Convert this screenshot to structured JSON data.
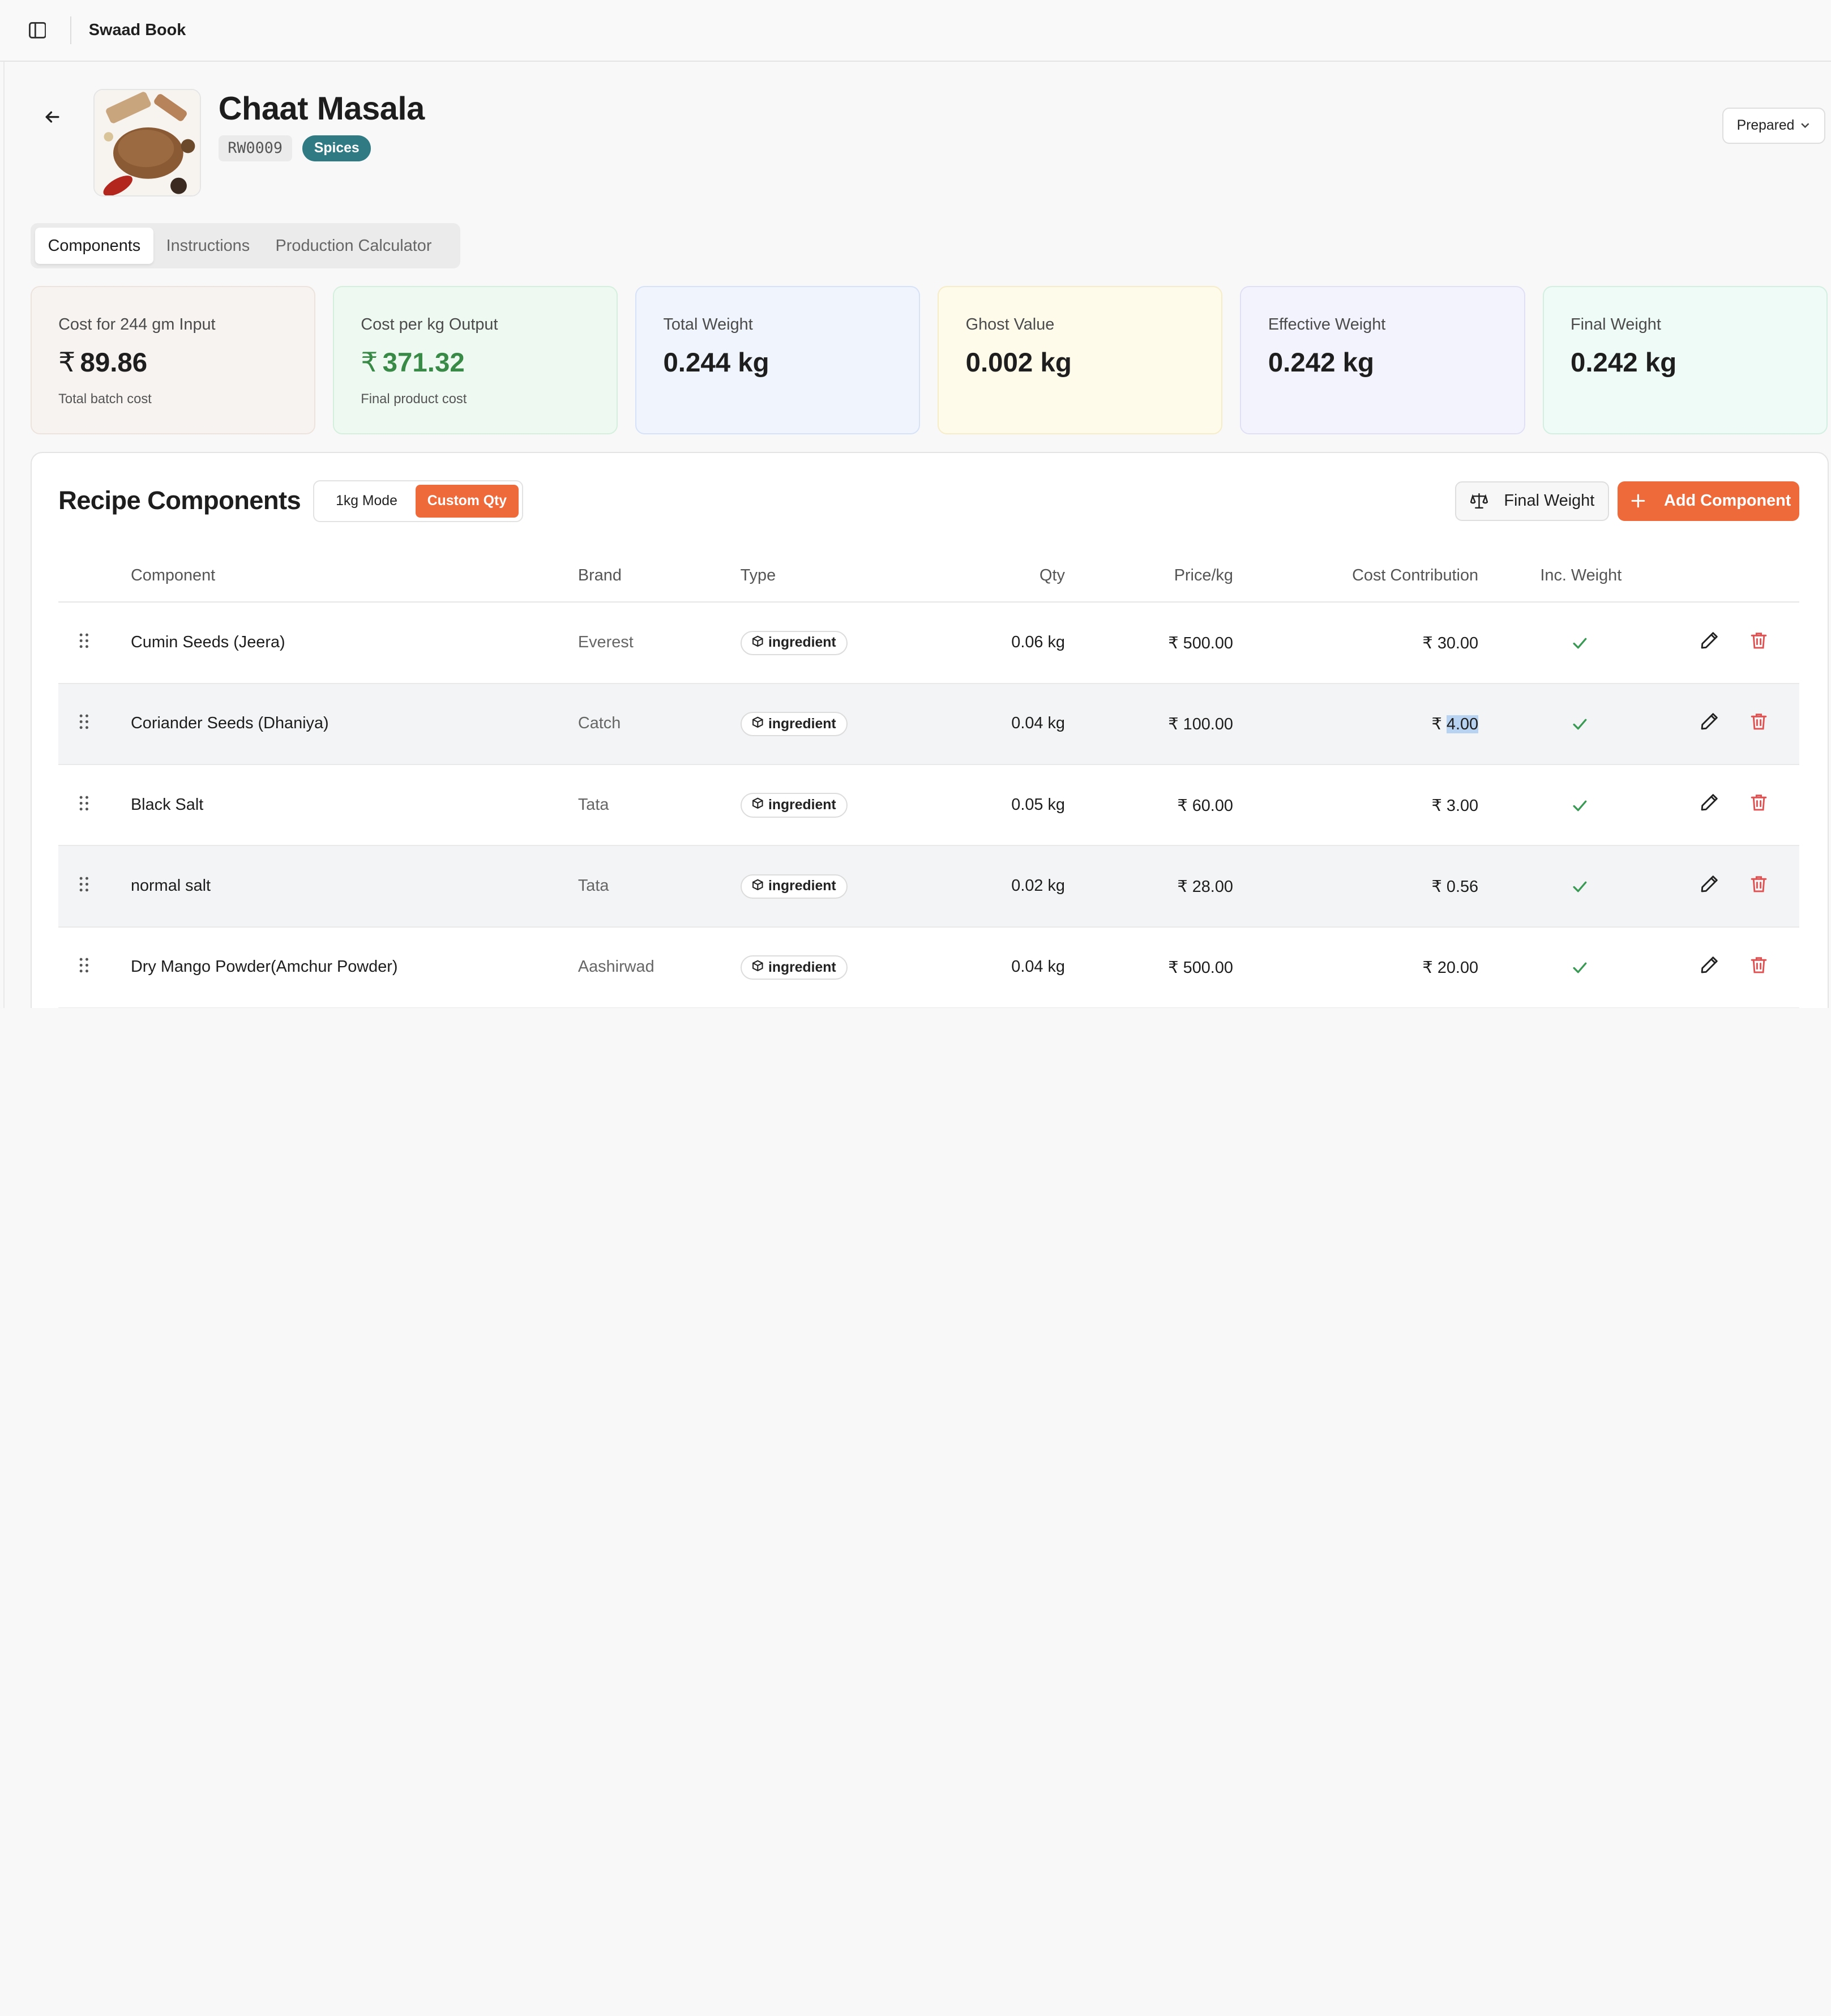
{
  "app": {
    "title": "Swaad Book"
  },
  "recipe": {
    "name": "Chaat Masala",
    "code": "RW0009",
    "category": "Spices",
    "state": "Prepared"
  },
  "tabs": [
    {
      "label": "Components",
      "active": true
    },
    {
      "label": "Instructions",
      "active": false
    },
    {
      "label": "Production Calculator",
      "active": false
    }
  ],
  "cards": [
    {
      "label": "Cost for 244 gm Input",
      "currency": "₹",
      "value": "89.86",
      "sub": "Total batch cost",
      "bg": "#f7f3f0",
      "border": "#ece3dc",
      "value_color": "#1e1e1e"
    },
    {
      "label": "Cost per kg Output",
      "currency": "₹",
      "value": "371.32",
      "sub": "Final product cost",
      "bg": "#eefaf1",
      "border": "#d5efdd",
      "value_color": "#3a8a47"
    },
    {
      "label": "Total Weight",
      "currency": "",
      "value": "0.244 kg",
      "sub": "",
      "bg": "#eff4fd",
      "border": "#d6e2f7",
      "value_color": "#1e1e1e"
    },
    {
      "label": "Ghost Value",
      "currency": "",
      "value": "0.002 kg",
      "sub": "",
      "bg": "#fffbeb",
      "border": "#f6ecc7",
      "value_color": "#1e1e1e"
    },
    {
      "label": "Effective Weight",
      "currency": "",
      "value": "0.242 kg",
      "sub": "",
      "bg": "#f3f3fd",
      "border": "#e0e0f5",
      "value_color": "#1e1e1e"
    },
    {
      "label": "Final Weight",
      "currency": "",
      "value": "0.242 kg",
      "sub": "",
      "bg": "#eefbf6",
      "border": "#d2efe2",
      "value_color": "#1e1e1e"
    }
  ],
  "components_panel": {
    "title": "Recipe Components",
    "mode_1kg": "1kg Mode",
    "mode_custom": "Custom Qty",
    "final_weight_button": "Final Weight",
    "add_button": "Add Component",
    "columns": {
      "component": "Component",
      "brand": "Brand",
      "type": "Type",
      "qty": "Qty",
      "price": "Price/kg",
      "cost": "Cost Contribution",
      "inc_weight": "Inc. Weight"
    },
    "rows": [
      {
        "name": "Cumin Seeds (Jeera)",
        "brand": "Everest",
        "type": "ingredient",
        "qty": "0.06 kg",
        "price": "₹ 500.00",
        "cost_currency": "₹",
        "cost_value": "30.00",
        "inc_weight": true
      },
      {
        "name": "Coriander Seeds (Dhaniya)",
        "brand": "Catch",
        "type": "ingredient",
        "qty": "0.04 kg",
        "price": "₹ 100.00",
        "cost_currency": "₹",
        "cost_value": "4.00",
        "inc_weight": true
      },
      {
        "name": "Black Salt",
        "brand": "Tata",
        "type": "ingredient",
        "qty": "0.05 kg",
        "price": "₹ 60.00",
        "cost_currency": "₹",
        "cost_value": "3.00",
        "inc_weight": true
      },
      {
        "name": "normal salt",
        "brand": "Tata",
        "type": "ingredient",
        "qty": "0.02 kg",
        "price": "₹ 28.00",
        "cost_currency": "₹",
        "cost_value": "0.56",
        "inc_weight": true
      },
      {
        "name": "Dry Mango Powder(Amchur Powder)",
        "brand": "Aashirwad",
        "type": "ingredient",
        "qty": "0.04 kg",
        "price": "₹ 500.00",
        "cost_currency": "₹",
        "cost_value": "20.00",
        "inc_weight": true
      }
    ]
  },
  "colors": {
    "accent": "#ef6a3a",
    "category_badge": "#2f7a83",
    "check": "#3a9a55",
    "delete": "#e05252"
  }
}
